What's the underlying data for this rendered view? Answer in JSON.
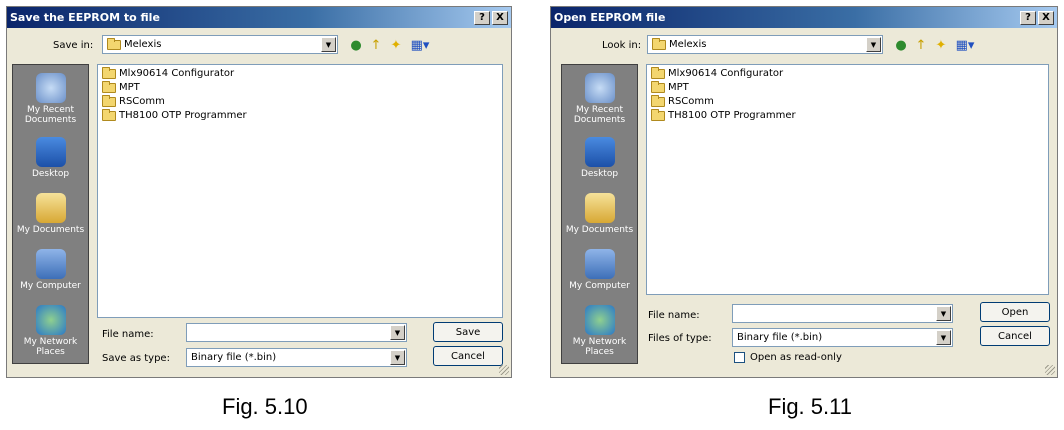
{
  "save_dialog": {
    "title": "Save the EEPROM to file",
    "help_btn": "?",
    "close_btn": "X",
    "location_label": "Save in:",
    "location_value": "Melexis",
    "places": [
      "My Recent Documents",
      "Desktop",
      "My Documents",
      "My Computer",
      "My Network Places"
    ],
    "files": [
      "Mlx90614 Configurator",
      "MPT",
      "RSComm",
      "TH8100 OTP Programmer"
    ],
    "filename_label": "File name:",
    "filename_value": "",
    "type_label": "Save as type:",
    "type_value": "Binary file (*.bin)",
    "primary_button": "Save",
    "cancel_button": "Cancel"
  },
  "open_dialog": {
    "title": "Open EEPROM file",
    "help_btn": "?",
    "close_btn": "X",
    "location_label": "Look in:",
    "location_value": "Melexis",
    "places": [
      "My Recent Documents",
      "Desktop",
      "My Documents",
      "My Computer",
      "My Network Places"
    ],
    "files": [
      "Mlx90614 Configurator",
      "MPT",
      "RSComm",
      "TH8100 OTP Programmer"
    ],
    "filename_label": "File name:",
    "filename_value": "",
    "type_label": "Files of type:",
    "type_value": "Binary file (*.bin)",
    "readonly_label": "Open as read-only",
    "primary_button": "Open",
    "cancel_button": "Cancel"
  },
  "captions": {
    "fig1": "Fig. 5.10",
    "fig2": "Fig. 5.11"
  },
  "colors": {
    "title_bar": "#0a246a",
    "dialog_bg": "#ece9d8",
    "places_bar": "#808080"
  },
  "icons": [
    "back-icon",
    "up-folder-icon",
    "new-folder-icon",
    "view-menu-icon",
    "folder-icon"
  ]
}
